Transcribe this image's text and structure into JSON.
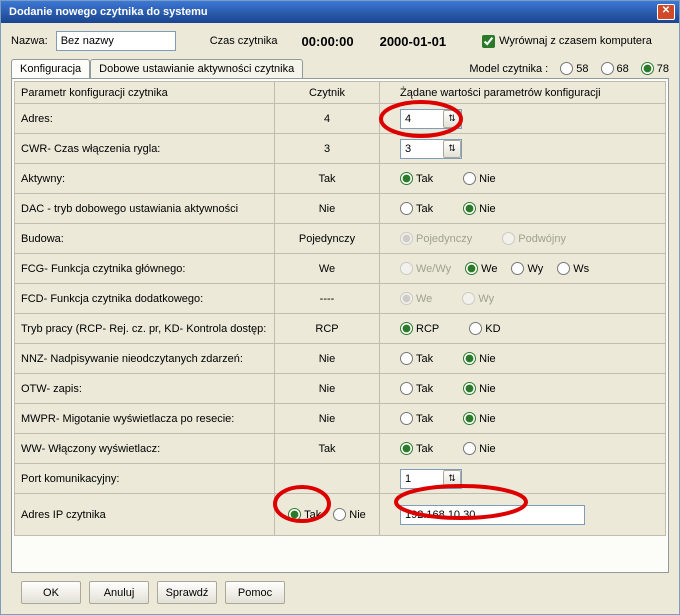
{
  "window": {
    "title": "Dodanie nowego czytnika do systemu",
    "close_glyph": "✕"
  },
  "row1": {
    "name_label": "Nazwa:",
    "name_value": "Bez nazwy",
    "time_label": "Czas czytnika",
    "time_value": "00:00:00",
    "date_value": "2000-01-01",
    "sync_checkbox": "Wyrównaj z czasem komputera"
  },
  "tabs": {
    "tab1": "Konfiguracja",
    "tab2": "Dobowe ustawianie aktywności czytnika"
  },
  "model": {
    "label": "Model czytnika :",
    "opt1": "58",
    "opt2": "68",
    "opt3": "78"
  },
  "headers": {
    "col1": "Parametr konfiguracji czytnika",
    "col2": "Czytnik",
    "col3": "Żądane wartości parametrów konfiguracji"
  },
  "rows": {
    "r0": {
      "label": "Adres:",
      "cur": "4",
      "val": "4"
    },
    "r1": {
      "label": "CWR- Czas włączenia rygla:",
      "cur": "3",
      "val": "3"
    },
    "r2": {
      "label": "Aktywny:",
      "cur": "Tak",
      "optA": "Tak",
      "optB": "Nie"
    },
    "r3": {
      "label": "DAC - tryb dobowego ustawiania aktywności",
      "cur": "Nie",
      "optA": "Tak",
      "optB": "Nie"
    },
    "r4": {
      "label": "Budowa:",
      "cur": "Pojedynczy",
      "optA": "Pojedynczy",
      "optB": "Podwójny"
    },
    "r5": {
      "label": "FCG- Funkcja czytnika głównego:",
      "cur": "We",
      "optA": "We/Wy",
      "optB": "We",
      "optC": "Wy",
      "optD": "Ws"
    },
    "r6": {
      "label": "FCD- Funkcja czytnika dodatkowego:",
      "cur": "----",
      "optA": "We",
      "optB": "Wy"
    },
    "r7": {
      "label": "Tryb pracy (RCP- Rej. cz. pr, KD- Kontrola dostęp:",
      "cur": "RCP",
      "optA": "RCP",
      "optB": "KD"
    },
    "r8": {
      "label": "NNZ- Nadpisywanie nieodczytanych zdarzeń:",
      "cur": "Nie",
      "optA": "Tak",
      "optB": "Nie"
    },
    "r9": {
      "label": "OTW- zapis:",
      "cur": "Nie",
      "optA": "Tak",
      "optB": "Nie"
    },
    "r10": {
      "label": "MWPR- Migotanie wyświetlacza po resecie:",
      "cur": "Nie",
      "optA": "Tak",
      "optB": "Nie"
    },
    "r11": {
      "label": "WW- Włączony wyświetlacz:",
      "cur": "Tak",
      "optA": "Tak",
      "optB": "Nie"
    },
    "r12": {
      "label": "Port komunikacyjny:",
      "cur": "",
      "val": "1"
    },
    "r13": {
      "label": "Adres IP czytnika",
      "optA": "Tak",
      "optB": "Nie",
      "ip": "192.168.10.30"
    }
  },
  "buttons": {
    "ok": "OK",
    "cancel": "Anuluj",
    "check": "Sprawdź",
    "help": "Pomoc"
  },
  "spin_glyph": "⇅"
}
